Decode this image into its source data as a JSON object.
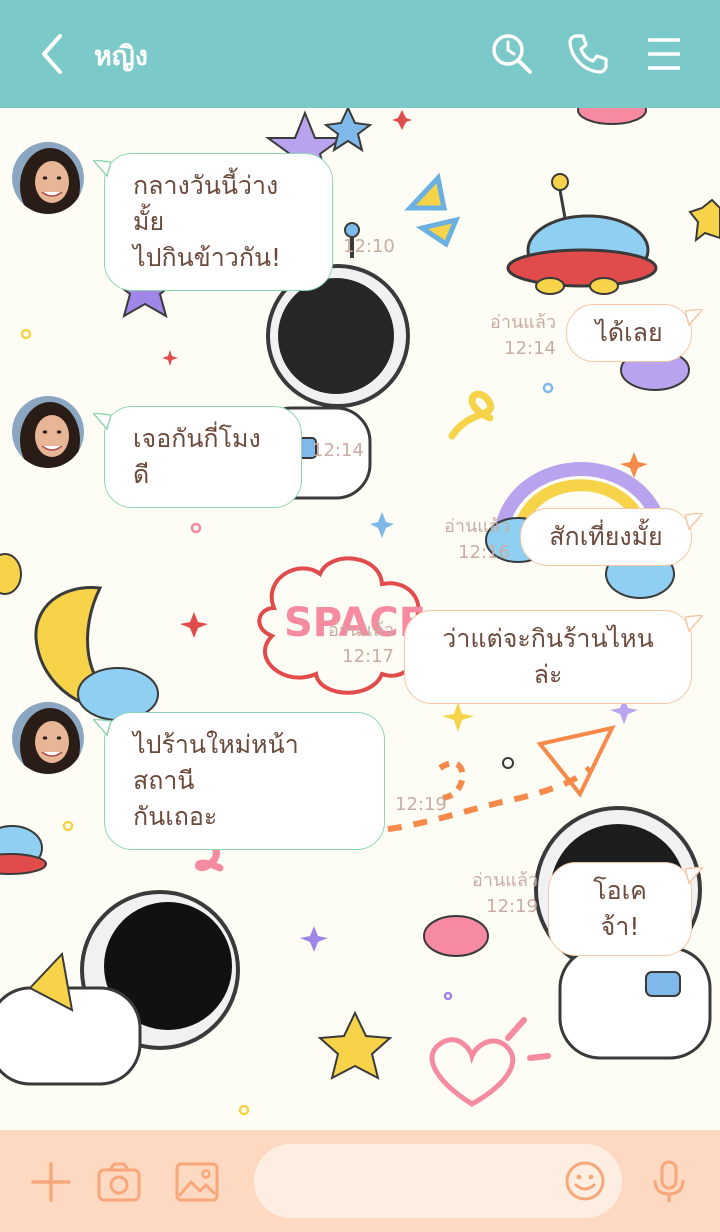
{
  "header": {
    "title": "หญิง",
    "bg_color": "#7cc9c9"
  },
  "theme": {
    "accent_in": "#8fd5b3",
    "accent_out": "#f5c7a4",
    "text_color": "#6b4a3c",
    "bottom_bar": "#fed9c2"
  },
  "messages": [
    {
      "side": "in",
      "lines": [
        "กลางวันนี้ว่างมั้ย",
        "ไปกินข้าวกัน!"
      ],
      "time": "12:10"
    },
    {
      "side": "out",
      "text": "ได้เลย",
      "read": "อ่านแล้ว",
      "time": "12:14"
    },
    {
      "side": "in",
      "text": "เจอกันกี่โมงดี",
      "time": "12:14"
    },
    {
      "side": "out",
      "text": "สักเที่ยงมั้ย",
      "read": "อ่านแล้ว",
      "time": "12:16"
    },
    {
      "side": "out",
      "text": "ว่าแต่จะกินร้านไหนล่ะ",
      "read": "อ่านแล้ว",
      "time": "12:17"
    },
    {
      "side": "in",
      "lines": [
        "ไปร้านใหม่หน้าสถานี",
        "กันเถอะ"
      ],
      "time": "12:19"
    },
    {
      "side": "out",
      "text": "โอเคจ้า!",
      "read": "อ่านแล้ว",
      "time": "12:19"
    }
  ],
  "composer": {
    "placeholder": "",
    "icons": [
      "plus-icon",
      "camera-icon",
      "image-icon",
      "emoji-icon",
      "microphone-icon"
    ]
  },
  "decor_text": "SPACE"
}
